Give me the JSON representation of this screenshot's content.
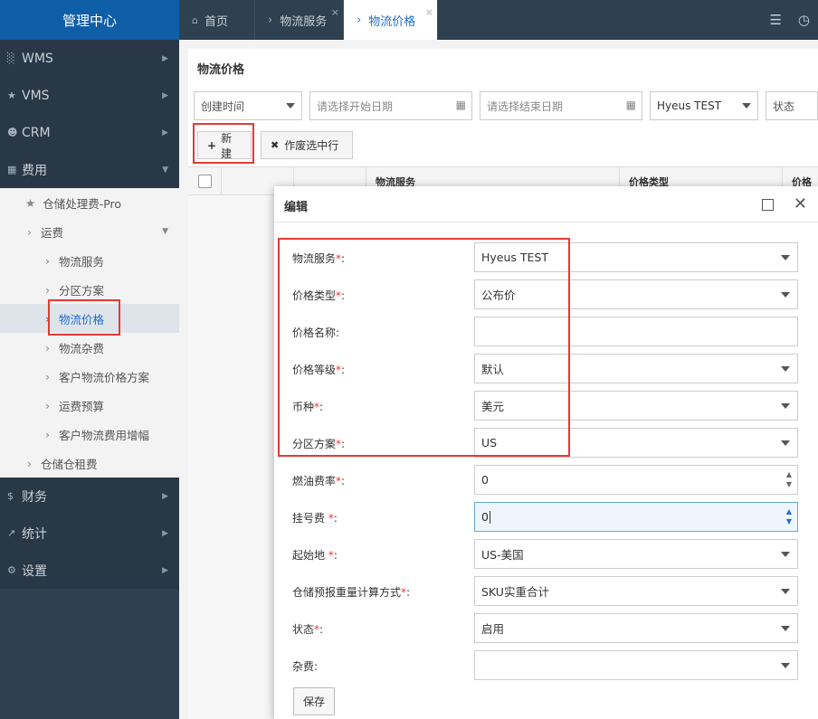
{
  "brand": "管理中心",
  "menu": {
    "wms": "WMS",
    "vms": "VMS",
    "crm": "CRM",
    "fee": "费用",
    "finance": "财务",
    "stats": "统计",
    "settings": "设置"
  },
  "submenu": {
    "storage_fee_pro": "仓储处理费-Pro",
    "freight": "运费",
    "logistics_service": "物流服务",
    "zone_plan": "分区方案",
    "logistics_price": "物流价格",
    "logistics_misc": "物流杂费",
    "customer_price_plan": "客户物流价格方案",
    "freight_budget": "运费预算",
    "customer_fee_increase": "客户物流费用增幅",
    "warehouse_rent": "仓储仓租费"
  },
  "tabs": {
    "home": "首页",
    "logistics_service": "物流服务",
    "logistics_price": "物流价格",
    "close": "×"
  },
  "page": {
    "title": "物流价格",
    "filters": {
      "date_type": "创建时间",
      "start_date": "请选择开始日期",
      "end_date": "请选择结束日期",
      "service": "Hyeus TEST",
      "status": "状态"
    },
    "buttons": {
      "new": "新建",
      "void": "作废选中行"
    },
    "columns": {
      "service": "物流服务",
      "price_type": "价格类型",
      "price_name": "价格名"
    }
  },
  "dialog": {
    "title": "编辑",
    "required_mark": "*",
    "fields": {
      "service": {
        "label": "物流服务",
        "value": "Hyeus TEST"
      },
      "price_type": {
        "label": "价格类型",
        "value": "公布价"
      },
      "price_name": {
        "label": "价格名称",
        "value": ""
      },
      "price_level": {
        "label": "价格等级",
        "value": "默认"
      },
      "currency": {
        "label": "币种",
        "value": "美元"
      },
      "zone_plan": {
        "label": "分区方案",
        "value": "US"
      },
      "fuel_rate": {
        "label": "燃油费率",
        "value": "0"
      },
      "registration_fee": {
        "label": "挂号费 ",
        "value": "0"
      },
      "origin": {
        "label": "起始地 ",
        "value": "US-美国"
      },
      "weight_method": {
        "label": "仓储预报重量计算方式",
        "value": "SKU实重合计"
      },
      "status": {
        "label": "状态",
        "value": "启用"
      },
      "misc_fee": {
        "label": "杂费",
        "value": ""
      }
    },
    "save": "保存",
    "colon": ":"
  },
  "colors": {
    "sidebar": "#2f4050",
    "brand": "#0f5ea8",
    "accent": "#1c6fd0",
    "highlight": "#e53935"
  }
}
